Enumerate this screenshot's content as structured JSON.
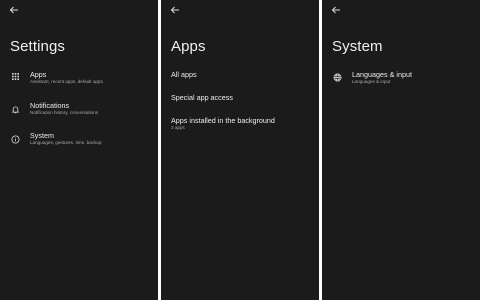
{
  "settings": {
    "title": "Settings",
    "items": [
      {
        "icon": "apps-grid-icon",
        "label": "Apps",
        "subtitle": "Assistant, recent apps, default apps"
      },
      {
        "icon": "bell-icon",
        "label": "Notifications",
        "subtitle": "Notification history, conversations"
      },
      {
        "icon": "info-icon",
        "label": "System",
        "subtitle": "Languages, gestures, time, backup"
      }
    ]
  },
  "apps": {
    "title": "Apps",
    "items": [
      {
        "label": "All apps"
      },
      {
        "label": "Special app access"
      },
      {
        "label": "Apps installed in the background",
        "subtitle": "3 apps"
      }
    ]
  },
  "system": {
    "title": "System",
    "items": [
      {
        "icon": "globe-icon",
        "label": "Languages & input",
        "subtitle": "Languages & input"
      }
    ]
  },
  "colors": {
    "background": "#1b1b1b",
    "text_primary": "#eeeeee",
    "text_secondary": "#a8a8a8"
  }
}
